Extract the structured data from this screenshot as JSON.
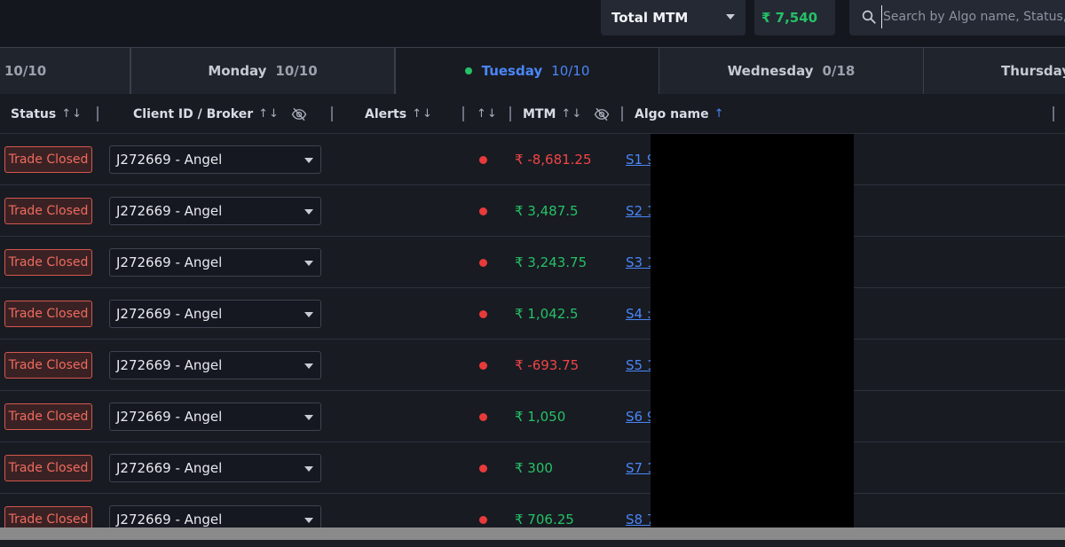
{
  "topbar": {
    "mtm_label": "Total MTM",
    "mtm_value": "₹ 7,540",
    "search_placeholder": "Search by Algo name, Status, Client ID"
  },
  "tabs": [
    {
      "label": "",
      "count": "10/10"
    },
    {
      "label": "Monday",
      "count": "10/10"
    },
    {
      "label": "Tuesday",
      "count": "10/10",
      "active": true
    },
    {
      "label": "Wednesday",
      "count": "0/18"
    },
    {
      "label": "Thursday",
      "count": ""
    }
  ],
  "columns": {
    "status": "Status",
    "client": "Client ID / Broker",
    "alerts": "Alerts",
    "mtm": "MTM",
    "algo": "Algo name"
  },
  "sort_arrows": "↑↓",
  "sort_active": "↑",
  "rows": [
    {
      "status": "Trade Closed",
      "client": "J272669 - Angel",
      "mtm": "₹ -8,681.25",
      "sign": "neg",
      "algo": "S1 9"
    },
    {
      "status": "Trade Closed",
      "client": "J272669 - Angel",
      "mtm": "₹ 3,487.5",
      "sign": "pos",
      "algo": "S2 1"
    },
    {
      "status": "Trade Closed",
      "client": "J272669 - Angel",
      "mtm": "₹ 3,243.75",
      "sign": "pos",
      "algo": "S3 1"
    },
    {
      "status": "Trade Closed",
      "client": "J272669 - Angel",
      "mtm": "₹ 1,042.5",
      "sign": "pos",
      "algo": "S4 :"
    },
    {
      "status": "Trade Closed",
      "client": "J272669 - Angel",
      "mtm": "₹ -693.75",
      "sign": "neg",
      "algo": "S5 1"
    },
    {
      "status": "Trade Closed",
      "client": "J272669 - Angel",
      "mtm": "₹ 1,050",
      "sign": "pos",
      "algo": "S6 9"
    },
    {
      "status": "Trade Closed",
      "client": "J272669 - Angel",
      "mtm": "₹ 300",
      "sign": "pos",
      "algo": "S7 1"
    },
    {
      "status": "Trade Closed",
      "client": "J272669 - Angel",
      "mtm": "₹ 706.25",
      "sign": "pos",
      "algo": "S8 7"
    }
  ],
  "colors": {
    "positive": "#26c166",
    "negative": "#f04545",
    "accent": "#4a86f7",
    "status_border": "#d4574e"
  }
}
